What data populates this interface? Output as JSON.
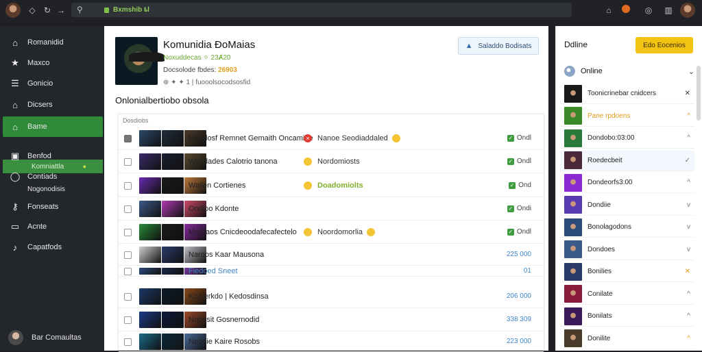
{
  "browser": {
    "url_text": "Bxmshib ȶl",
    "icons": [
      "avatar",
      "back-icon",
      "refresh-icon",
      "forward-icon",
      "home-icon",
      "extensions-icon",
      "profile-icon",
      "sidebar-icon"
    ]
  },
  "sidebar": {
    "items": [
      {
        "icon": "home-icon",
        "label": "Romanidid"
      },
      {
        "icon": "star-icon",
        "label": "Maxco"
      },
      {
        "icon": "list-icon",
        "label": "Gonicio"
      },
      {
        "icon": "store-icon",
        "label": "Dicsers"
      },
      {
        "icon": "gamepad-icon",
        "label": "Bame"
      },
      {
        "icon": "apps-icon",
        "label": "Benfod"
      },
      {
        "icon": "chat-icon",
        "label": "Contiads"
      },
      {
        "icon": "key-icon",
        "label": "Fonseats"
      },
      {
        "icon": "monitor-icon",
        "label": "Acnte"
      },
      {
        "icon": "music-icon",
        "label": "Capatfods"
      }
    ],
    "sub_item": "Komniattla",
    "sub_ext": "Nogonodisis",
    "footer_label": "Bar Comaultas"
  },
  "profile": {
    "name": "Komunidia ÐoMaias",
    "stat1": "Noxuddecas ✧ 23Ⱥ20",
    "stat2_label": "Docsolode fbdes:",
    "stat2_value": "26903",
    "stat3": "⊕ ✦ ✦ 1 | fuooolsocodsosfid",
    "subscribe_label": "Saladdo Bodisats"
  },
  "section_title": "Onlonialbertiobo obsola",
  "table": {
    "header": "Dosdiobs",
    "rows": [
      {
        "name": "Mendosf Remnet Gemaith Oncamibe",
        "mid": "Nanoe Seodiaddaled",
        "mid_icon": "red",
        "warn": true,
        "status": "Ondl",
        "kind": "status",
        "checked": true
      },
      {
        "name": "Wcridades Calotrio tanona",
        "mid": "Nordomiosts",
        "mid_icon": "yellow",
        "warn": false,
        "status": "Ondl",
        "kind": "status",
        "checked": false
      },
      {
        "name": "Walien Cortienes",
        "mid": "Doadomiolts",
        "mid_icon": "yellow",
        "warn": false,
        "status": "Ond",
        "kind": "status",
        "checked": false,
        "mid_hl": true
      },
      {
        "name": "Ondioo Kdonte",
        "mid": "",
        "mid_icon": "",
        "warn": false,
        "status": "Ondi",
        "kind": "status",
        "checked": false
      },
      {
        "name": "Mardaos Cnicdeoodafecafectelo",
        "mid": "Noordomorlia",
        "mid_icon": "yellow",
        "warn": true,
        "status": "Ondl",
        "kind": "status",
        "checked": false
      },
      {
        "name": "Naroos Kaar Mausona",
        "mid": "",
        "mid_icon": "",
        "warn": false,
        "status": "225 000",
        "kind": "number",
        "checked": false
      },
      {
        "name": "Fiedoed Sneet",
        "mid": "",
        "mid_icon": "",
        "warn": false,
        "status": "01",
        "kind": "number",
        "checked": false,
        "link": true
      },
      {
        "name": "KcAlerkdo | Kedosdinsa",
        "mid": "",
        "mid_icon": "",
        "warn": false,
        "status": "206 000",
        "kind": "number",
        "checked": false
      },
      {
        "name": "Nobosit Gosnernodid",
        "mid": "",
        "mid_icon": "",
        "warn": false,
        "status": "338 309",
        "kind": "number",
        "checked": false
      },
      {
        "name": "Nebaie Kaire Rosobs",
        "mid": "",
        "mid_icon": "",
        "warn": false,
        "status": "223 000",
        "kind": "number",
        "checked": false
      }
    ]
  },
  "right_panel": {
    "title": "Ddline",
    "button_label": "Edo Eocenios",
    "dropdown_label": "Online",
    "friends": [
      {
        "name": "Toonicrinebar cnidcers",
        "action": "✕",
        "action_kind": "x",
        "hl": false,
        "name_kind": ""
      },
      {
        "name": "Pane rpdoens",
        "action": "^",
        "action_kind": "o",
        "hl": false,
        "name_kind": "y"
      },
      {
        "name": "Dondobo:03:00",
        "action": "^",
        "action_kind": "",
        "hl": false,
        "name_kind": ""
      },
      {
        "name": "Roedecbeit",
        "action": "✓",
        "action_kind": "",
        "hl": true,
        "name_kind": ""
      },
      {
        "name": "Dondeorfs3:00",
        "action": "^",
        "action_kind": "",
        "hl": false,
        "name_kind": ""
      },
      {
        "name": "Dondiie",
        "action": "v",
        "action_kind": "",
        "hl": false,
        "name_kind": ""
      },
      {
        "name": "Bonolagodons",
        "action": "v",
        "action_kind": "",
        "hl": false,
        "name_kind": ""
      },
      {
        "name": "Dondoes",
        "action": "v",
        "action_kind": "",
        "hl": false,
        "name_kind": ""
      },
      {
        "name": "Bonilies",
        "action": "✕",
        "action_kind": "o",
        "hl": false,
        "name_kind": ""
      },
      {
        "name": "Conilate",
        "action": "^",
        "action_kind": "",
        "hl": false,
        "name_kind": ""
      },
      {
        "name": "Bonilats",
        "action": "^",
        "action_kind": "",
        "hl": false,
        "name_kind": ""
      },
      {
        "name": "Donilite",
        "action": "^",
        "action_kind": "o",
        "hl": false,
        "name_kind": ""
      }
    ]
  },
  "colors": {
    "accent_green": "#2f8a3a",
    "accent_yellow": "#f2c313",
    "link_blue": "#3e85c6"
  }
}
